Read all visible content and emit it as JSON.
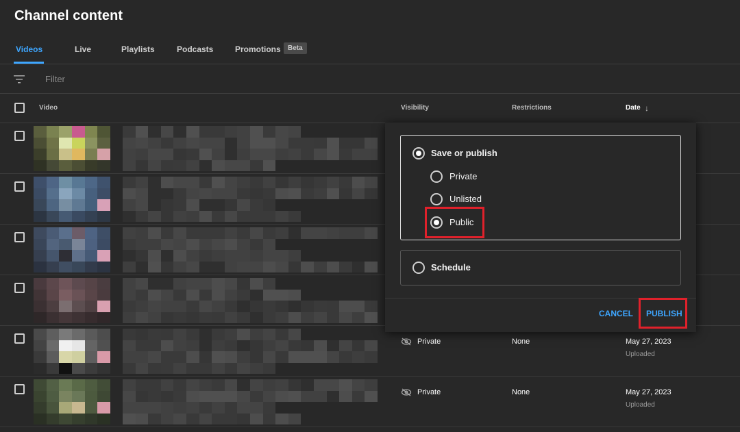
{
  "page": {
    "title": "Channel content"
  },
  "tabs": [
    {
      "label": "Videos",
      "active": true
    },
    {
      "label": "Live"
    },
    {
      "label": "Playlists"
    },
    {
      "label": "Podcasts"
    },
    {
      "label": "Promotions",
      "badge": "Beta"
    }
  ],
  "filter": {
    "placeholder": "Filter",
    "icon": "filter-icon"
  },
  "table": {
    "columns": {
      "video": "Video",
      "visibility": "Visibility",
      "restrictions": "Restrictions",
      "date": "Date",
      "date_sort": "↓"
    },
    "rows": [
      {
        "visibility": "",
        "restrictions": "",
        "date": "",
        "status": ""
      },
      {
        "visibility": "",
        "restrictions": "",
        "date": "",
        "status": ""
      },
      {
        "visibility": "",
        "restrictions": "",
        "date": "",
        "status": ""
      },
      {
        "visibility": "",
        "restrictions": "",
        "date": "",
        "status": ""
      },
      {
        "visibility": "Private",
        "restrictions": "None",
        "date": "May 27, 2023",
        "status": "Uploaded"
      },
      {
        "visibility": "Private",
        "restrictions": "None",
        "date": "May 27, 2023",
        "status": "Uploaded"
      }
    ]
  },
  "visibility_popup": {
    "save_or_publish": "Save or publish",
    "options": [
      "Private",
      "Unlisted",
      "Public"
    ],
    "selected": "Public",
    "schedule": "Schedule",
    "cancel": "CANCEL",
    "publish": "PUBLISH"
  },
  "colors": {
    "accent": "#3ea6ff",
    "highlight": "#e0212b",
    "background": "#282828"
  }
}
